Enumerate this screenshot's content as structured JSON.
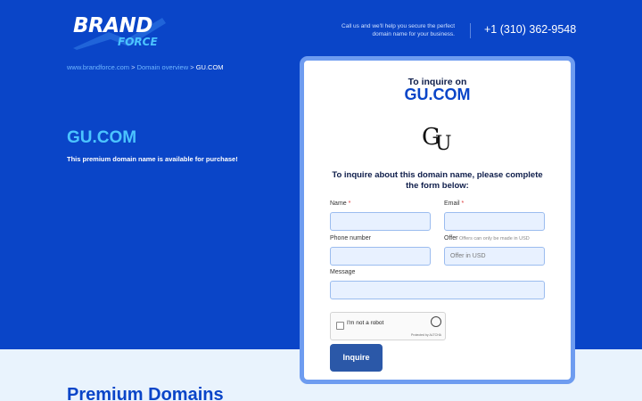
{
  "header": {
    "logo_brand": "BRAND",
    "logo_force": "FORCE",
    "callus_text": "Call us and we'll help you secure the perfect domain name for your business.",
    "phone": "+1 (310) 362-9548"
  },
  "breadcrumb": {
    "home": "www.brandforce.com",
    "sep1": " > ",
    "overview": "Domain overview",
    "sep2": " > ",
    "current": "GU.COM"
  },
  "hero": {
    "domain": "GU.COM",
    "subtitle": "This premium domain name is available for purchase!"
  },
  "card": {
    "inquire_on": "To inquire on",
    "domain": "GU.COM",
    "monogram": "GU",
    "form_heading": "To inquire about this domain name, please complete the form below:",
    "fields": {
      "name_label": "Name",
      "email_label": "Email",
      "required_mark": " *",
      "phone_label": "Phone number",
      "offer_label": "Offer",
      "offer_hint": " Offers can only be made in USD",
      "offer_placeholder": "Offer in USD",
      "message_label": "Message"
    },
    "captcha": {
      "label": "I'm not a robot",
      "protected_by": "Protected by ALTCHA"
    },
    "submit_label": "Inquire"
  },
  "lower": {
    "section_title": "Premium Domains"
  },
  "colors": {
    "hero_bg": "#0a45c8",
    "accent": "#4bc4ff",
    "lower_bg": "#e9f3fd",
    "button": "#2b58a8",
    "card_border": "#6e9cf0"
  }
}
